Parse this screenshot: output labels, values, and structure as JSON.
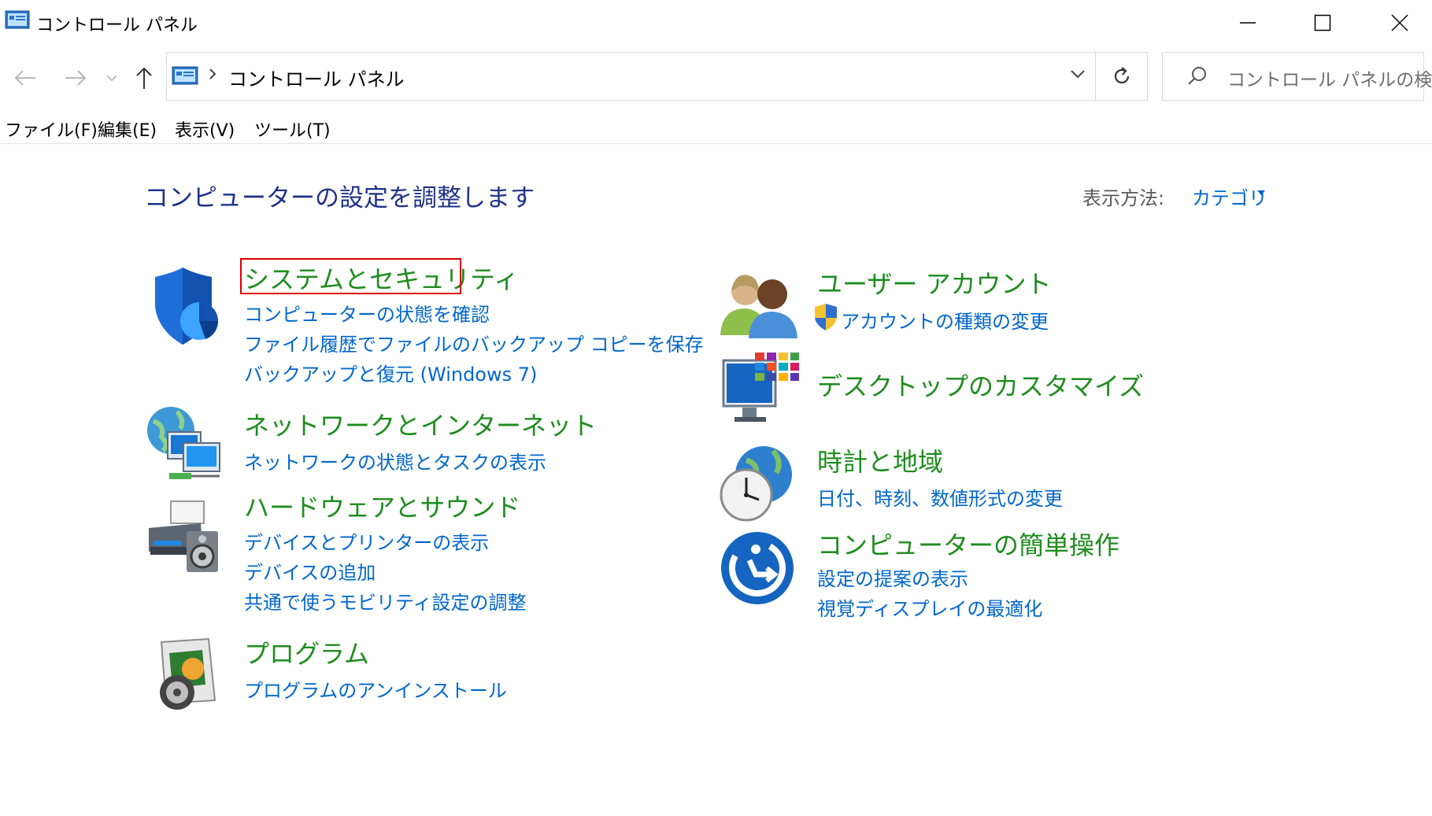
{
  "window": {
    "title": "コントロール パネル"
  },
  "address": {
    "crumb": "コントロール パネル"
  },
  "search": {
    "placeholder": "コントロール パネルの検索"
  },
  "menu": [
    "ファイル(F)",
    "編集(E)",
    "表示(V)",
    "ツール(T)"
  ],
  "main": {
    "heading": "コンピューターの設定を調整します",
    "view_by_label": "表示方法:",
    "view_by_value": "カテゴリ"
  },
  "categories": [
    {
      "title": "システムとセキュリティ",
      "links": [
        "コンピューターの状態を確認",
        "ファイル履歴でファイルのバックアップ コピーを保存",
        "バックアップと復元 (Windows 7)"
      ]
    },
    {
      "title": "ネットワークとインターネット",
      "links": [
        "ネットワークの状態とタスクの表示"
      ]
    },
    {
      "title": "ハードウェアとサウンド",
      "links": [
        "デバイスとプリンターの表示",
        "デバイスの追加",
        "共通で使うモビリティ設定の調整"
      ]
    },
    {
      "title": "プログラム",
      "links": [
        "プログラムのアンインストール"
      ]
    },
    {
      "title": "ユーザー アカウント",
      "links": [
        "アカウントの種類の変更"
      ]
    },
    {
      "title": "デスクトップのカスタマイズ",
      "links": []
    },
    {
      "title": "時計と地域",
      "links": [
        "日付、時刻、数値形式の変更"
      ]
    },
    {
      "title": "コンピューターの簡単操作",
      "links": [
        "設定の提案の表示",
        "視覚ディスプレイの最適化"
      ]
    }
  ],
  "colors": {
    "category_title": "#1e8c1e",
    "link": "#0066cc",
    "heading": "#1e3287",
    "highlight_border": "#e00000"
  }
}
